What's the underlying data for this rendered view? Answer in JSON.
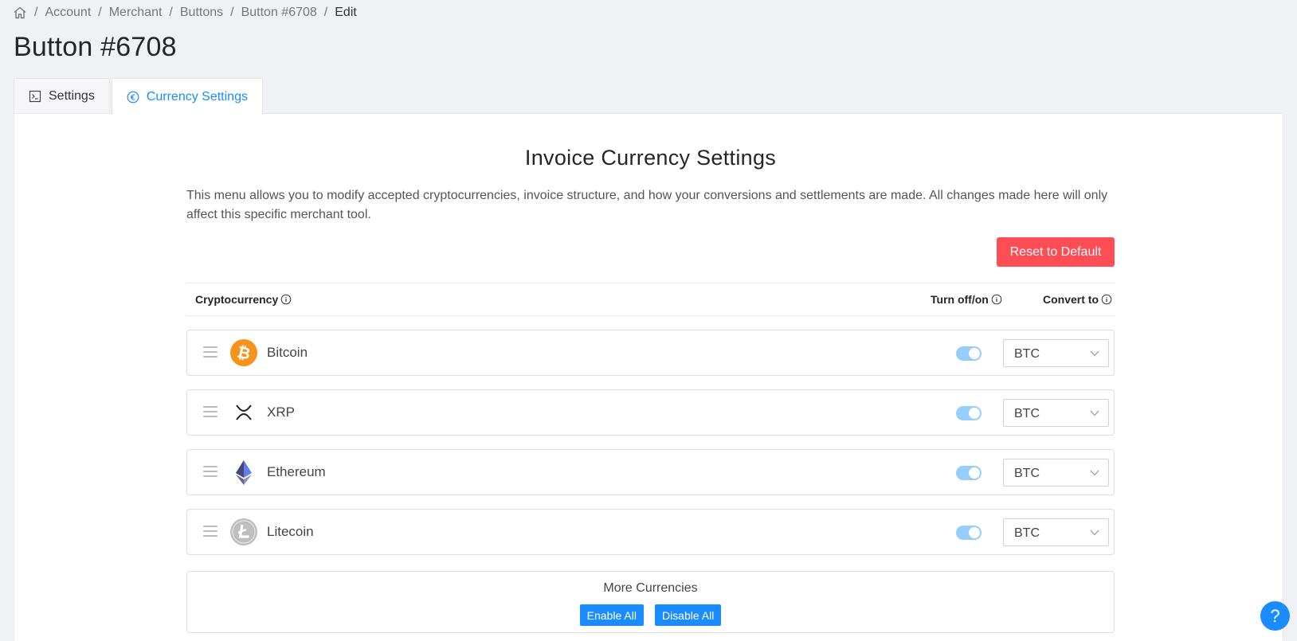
{
  "breadcrumb": {
    "home_icon": "home-icon",
    "items": [
      "Account",
      "Merchant",
      "Buttons",
      "Button #6708",
      "Edit"
    ],
    "separator": "/"
  },
  "page": {
    "title": "Button #6708"
  },
  "tabs": [
    {
      "label": "Settings",
      "icon": "terminal-icon",
      "active": false
    },
    {
      "label": "Currency Settings",
      "icon": "euro-circle-icon",
      "active": true
    }
  ],
  "section": {
    "title": "Invoice Currency Settings",
    "description": "This menu allows you to modify accepted cryptocurrencies, invoice structure, and how your conversions and settlements are made. All changes made here will only affect this specific merchant tool.",
    "reset_label": "Reset to Default"
  },
  "table": {
    "col_crypto": "Cryptocurrency",
    "col_toggle": "Turn off/on",
    "col_convert": "Convert to"
  },
  "currencies": [
    {
      "name": "Bitcoin",
      "icon": "bitcoin-icon",
      "enabled": true,
      "convert_to": "BTC"
    },
    {
      "name": "XRP",
      "icon": "xrp-icon",
      "enabled": true,
      "convert_to": "BTC"
    },
    {
      "name": "Ethereum",
      "icon": "ethereum-icon",
      "enabled": true,
      "convert_to": "BTC"
    },
    {
      "name": "Litecoin",
      "icon": "litecoin-icon",
      "enabled": true,
      "convert_to": "BTC"
    }
  ],
  "more": {
    "label": "More Currencies",
    "enable_all": "Enable All",
    "disable_all": "Disable All"
  },
  "help": {
    "label": "?"
  },
  "colors": {
    "accent": "#1a8cff",
    "danger": "#ff4d56",
    "toggle_on": "#95cdfb",
    "bitcoin": "#f7931a",
    "ethereum": "#627eea",
    "litecoin": "#bebebe"
  }
}
